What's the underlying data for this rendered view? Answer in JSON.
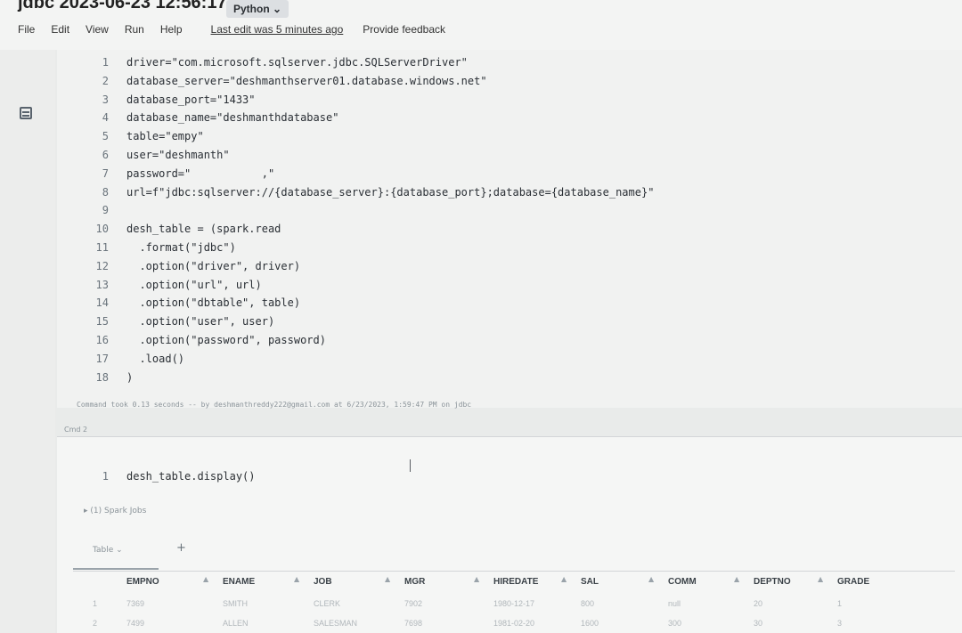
{
  "header": {
    "title": "jdbc 2023-06-23 12:56:17",
    "language": "Python",
    "menu": [
      "File",
      "Edit",
      "View",
      "Run",
      "Help"
    ],
    "last_edit": "Last edit was 5 minutes ago",
    "feedback": "Provide feedback"
  },
  "cell1": {
    "lines": [
      {
        "n": "1",
        "text": "driver=\"com.microsoft.sqlserver.jdbc.SQLServerDriver\""
      },
      {
        "n": "2",
        "text": "database_server=\"deshmanthserver01.database.windows.net\""
      },
      {
        "n": "3",
        "text": "database_port=\"1433\""
      },
      {
        "n": "4",
        "text": "database_name=\"deshmanthdatabase\""
      },
      {
        "n": "5",
        "text": "table=\"empy\""
      },
      {
        "n": "6",
        "text": "user=\"deshmanth\""
      },
      {
        "n": "7",
        "text": "password=\"           ,\""
      },
      {
        "n": "8",
        "text": "url=f\"jdbc:sqlserver://{database_server}:{database_port};database={database_name}\""
      },
      {
        "n": "9",
        "text": ""
      },
      {
        "n": "10",
        "text": "desh_table = (spark.read"
      },
      {
        "n": "11",
        "text": "  .format(\"jdbc\")"
      },
      {
        "n": "12",
        "text": "  .option(\"driver\", driver)"
      },
      {
        "n": "13",
        "text": "  .option(\"url\", url)"
      },
      {
        "n": "14",
        "text": "  .option(\"dbtable\", table)"
      },
      {
        "n": "15",
        "text": "  .option(\"user\", user)"
      },
      {
        "n": "16",
        "text": "  .option(\"password\", password)"
      },
      {
        "n": "17",
        "text": "  .load()"
      },
      {
        "n": "18",
        "text": ")"
      }
    ],
    "status": "Command took 0.13 seconds -- by deshmanthreddy222@gmail.com at 6/23/2023, 1:59:47 PM on jdbc"
  },
  "cell2": {
    "label": "Cmd 2",
    "line_num": "1",
    "code": "desh_table.display()",
    "spark_jobs": "▸ (1) Spark Jobs",
    "tab": "Table",
    "columns": [
      "EMPNO",
      "ENAME",
      "JOB",
      "MGR",
      "HIREDATE",
      "SAL",
      "COMM",
      "DEPTNO",
      "GRADE"
    ],
    "rows": [
      {
        "idx": "1",
        "cells": [
          "7369",
          "SMITH",
          "CLERK",
          "7902",
          "1980-12-17",
          "800",
          "null",
          "20",
          "1"
        ]
      },
      {
        "idx": "2",
        "cells": [
          "7499",
          "ALLEN",
          "SALESMAN",
          "7698",
          "1981-02-20",
          "1600",
          "300",
          "30",
          "3"
        ]
      }
    ]
  }
}
